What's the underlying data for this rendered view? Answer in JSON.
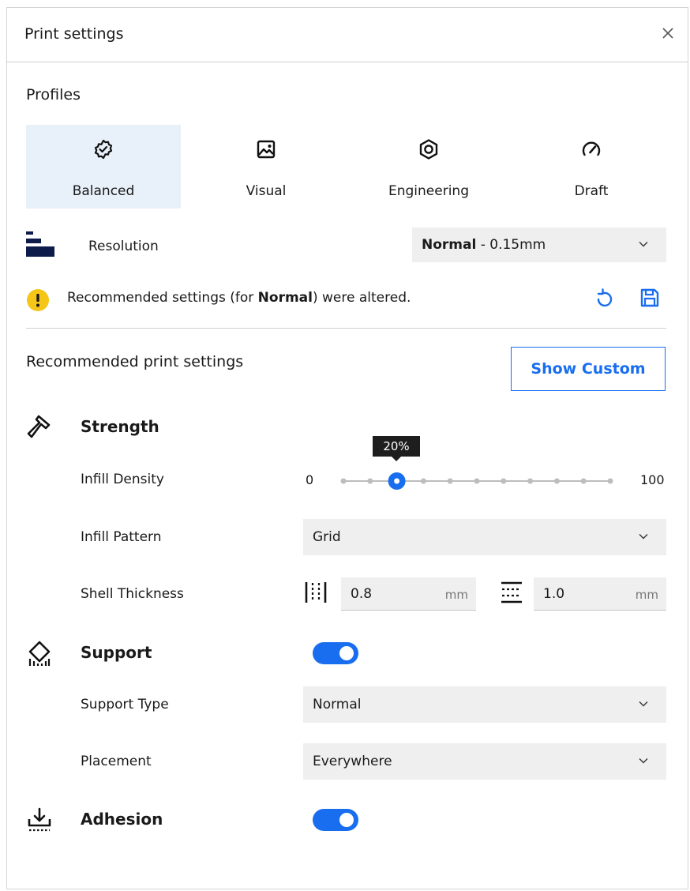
{
  "header": {
    "title": "Print settings",
    "close_glyph": "×"
  },
  "profiles_section": {
    "label": "Profiles",
    "items": [
      {
        "label": "Balanced",
        "icon": "gear-check-icon",
        "selected": true
      },
      {
        "label": "Visual",
        "icon": "image-icon",
        "selected": false
      },
      {
        "label": "Engineering",
        "icon": "hex-nut-icon",
        "selected": false
      },
      {
        "label": "Draft",
        "icon": "gauge-icon",
        "selected": false
      }
    ]
  },
  "resolution": {
    "label": "Resolution",
    "value_bold": "Normal",
    "value_rest": " - 0.15mm",
    "icon": "layer-bars-icon"
  },
  "warning": {
    "text_before": "Recommended settings (for ",
    "text_bold": "Normal",
    "text_after": ") were altered.",
    "icon": "exclamation-icon"
  },
  "recommended": {
    "title": "Recommended print settings",
    "show_custom_label": "Show Custom"
  },
  "strength": {
    "title": "Strength",
    "icon": "hammer-icon",
    "infill_density": {
      "label": "Infill Density",
      "min": "0",
      "max": "100",
      "value": 20,
      "tooltip": "20%",
      "steps": 11
    },
    "infill_pattern": {
      "label": "Infill Pattern",
      "value": "Grid"
    },
    "shell_thickness": {
      "label": "Shell Thickness",
      "wall": {
        "value": "0.8",
        "unit": "mm",
        "icon": "wall-thickness-icon"
      },
      "top_bottom": {
        "value": "1.0",
        "unit": "mm",
        "icon": "top-bottom-thickness-icon"
      }
    }
  },
  "support": {
    "title": "Support",
    "icon": "support-icon",
    "enabled": true,
    "support_type": {
      "label": "Support Type",
      "value": "Normal"
    },
    "placement": {
      "label": "Placement",
      "value": "Everywhere"
    }
  },
  "adhesion": {
    "title": "Adhesion",
    "icon": "adhesion-icon",
    "enabled": true
  },
  "colors": {
    "accent": "#196ef0",
    "selected_bg": "#e8f0f9",
    "warning": "#f5c518",
    "field_bg": "#efefef"
  }
}
